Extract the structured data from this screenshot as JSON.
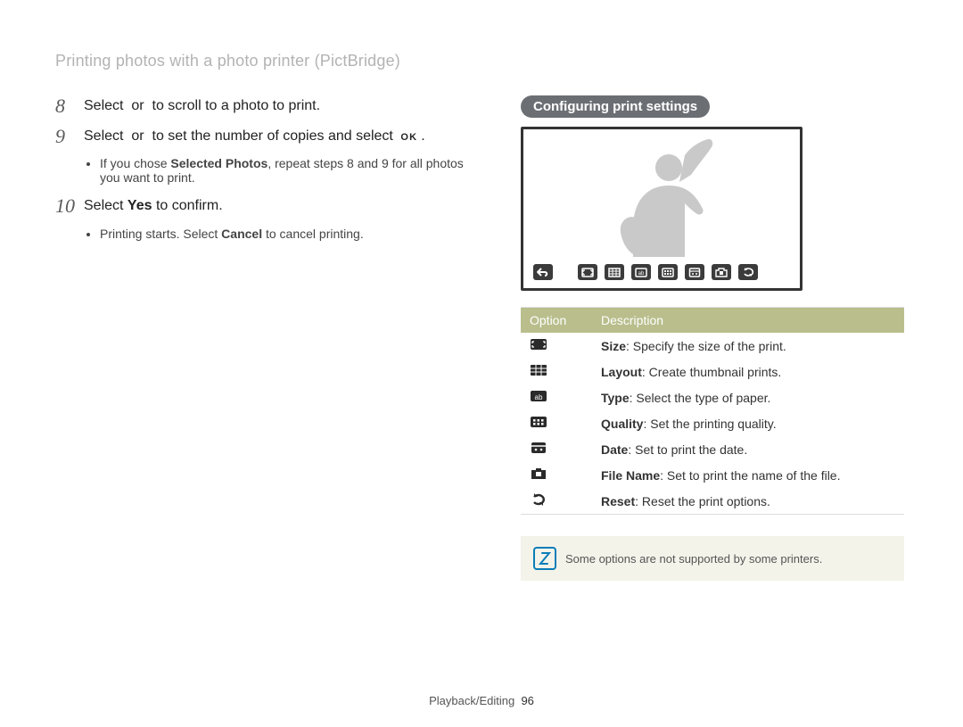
{
  "header": {
    "title": "Printing photos with a photo printer (PictBridge)"
  },
  "steps": {
    "s8": {
      "num": "8",
      "pre": "Select ",
      "mid": " or ",
      "post": " to scroll to a photo to print."
    },
    "s9": {
      "num": "9",
      "pre": "Select ",
      "mid": " or ",
      "post": " to set the number of copies and select ",
      "ok": "OK",
      "period": ".",
      "bullet_pre": "If you chose ",
      "bullet_bold": "Selected Photos",
      "bullet_post": ", repeat steps 8 and 9 for all photos you want to print."
    },
    "s10": {
      "num": "10",
      "pre": "Select ",
      "bold": "Yes",
      "post": " to confirm.",
      "bullet_pre": "Printing starts. Select ",
      "bullet_bold": "Cancel",
      "bullet_post": " to cancel printing."
    }
  },
  "right": {
    "pill": "Configuring print settings",
    "table": {
      "head_option": "Option",
      "head_desc": "Description",
      "rows": [
        {
          "bold": "Size",
          "desc": ": Specify the size of the print."
        },
        {
          "bold": "Layout",
          "desc": ": Create thumbnail prints."
        },
        {
          "bold": "Type",
          "desc": ": Select the type of paper."
        },
        {
          "bold": "Quality",
          "desc": ": Set the printing quality."
        },
        {
          "bold": "Date",
          "desc": ": Set to print the date."
        },
        {
          "bold": "File Name",
          "desc": ": Set to print the name of the file."
        },
        {
          "bold": "Reset",
          "desc": ": Reset the print options."
        }
      ]
    },
    "note": "Some options are not supported by some printers."
  },
  "footer": {
    "section": "Playback/Editing",
    "page": "96"
  }
}
